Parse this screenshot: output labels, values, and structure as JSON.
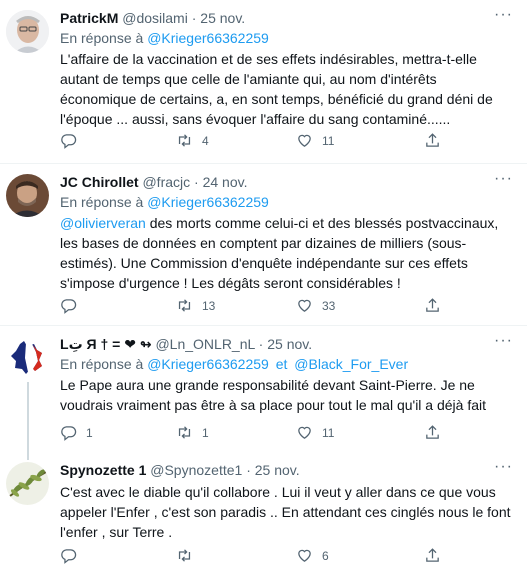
{
  "tweets": [
    {
      "name": "PatrickM",
      "handle": "@dosilami",
      "date": "25 nov.",
      "reply_prefix": "En réponse à",
      "reply_to": [
        "@Krieger66362259"
      ],
      "text": "L'affaire de la vaccination et de ses effets indésirables, mettra-t-elle autant de temps que celle de l'amiante qui, au nom d'intérêts économique de certains, a, en sont temps, bénéficié du grand déni de l'époque ... aussi, sans évoquer l'affaire du sang contaminé......",
      "mention": "",
      "retweets": "4",
      "likes": "11"
    },
    {
      "name": "JC Chirollet",
      "handle": "@fracjc",
      "date": "24 nov.",
      "reply_prefix": "En réponse à",
      "reply_to": [
        "@Krieger66362259"
      ],
      "mention": "@olivierveran",
      "text": " des morts comme celui-ci et des blessés postvaccinaux, les bases de données en comptent par dizaines de milliers (sous-estimés). Une Commission d'enquête indépendante sur ces effets s'impose d'urgence ! Les dégâts seront considérables !",
      "retweets": "13",
      "likes": "33"
    },
    {
      "name": "Lتِ Я † = ❤ ↬",
      "handle": "@Ln_ONLR_nL",
      "date": "25 nov.",
      "reply_prefix": "En réponse à",
      "reply_to": [
        "@Krieger66362259",
        "@Black_For_Ever"
      ],
      "reply_joiner": "et",
      "mention": "",
      "text": "Le Pape aura une grande responsabilité devant Saint-Pierre. Je ne voudrais vraiment pas être à sa place pour tout le mal qu'il a déjà fait",
      "replies": "1",
      "retweets": "1",
      "likes": "11"
    },
    {
      "name": "Spynozette 1",
      "handle": "@Spynozette1",
      "date": "25 nov.",
      "mention": "",
      "text": "C'est avec le diable qu'il collabore . Lui il veut y aller dans ce que vous appeler l'Enfer , c'est son paradis .. En attendant ces cinglés nous le font l'enfer , sur Terre .",
      "likes": "6"
    }
  ],
  "separator": "·",
  "icons": [
    "reply-icon",
    "retweet-icon",
    "like-icon",
    "share-icon",
    "more-icon"
  ],
  "colors": {
    "link": "#1d9bf0",
    "muted": "#536471",
    "text": "#0f1419",
    "border": "#eff3f4"
  }
}
